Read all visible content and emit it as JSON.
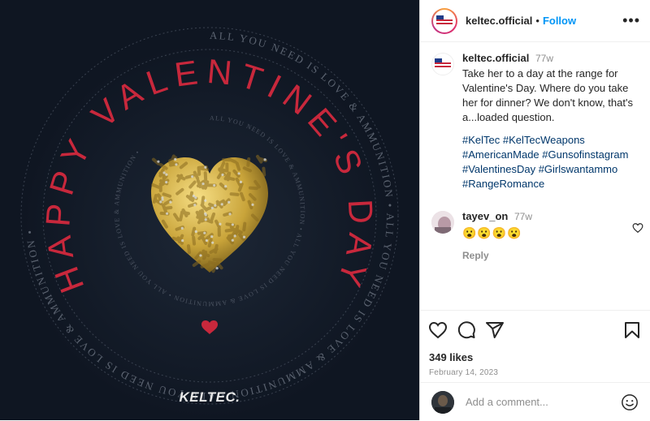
{
  "media": {
    "outer_ring_text": "ALL YOU NEED IS LOVE & AMMUNITION • ALL YOU NEED IS LOVE & AMMUNITION • ALL YOU NEED IS LOVE & AMMUNITION • ",
    "inner_ring_text": "ALL YOU NEED IS LOVE & AMMUNITION • ALL YOU NEED IS LOVE & AMMUNITION • ALL YOU NEED IS LOVE & AMMUNITION • ",
    "headline": "HAPPY VALENTINE'S DAY",
    "brand_logo": "KELTEC.",
    "colors": {
      "background": "#0f1622",
      "headline": "#c8283c",
      "ring_text": "#5b6370",
      "bullets": "#c9a43a"
    }
  },
  "header": {
    "username": "keltec.official",
    "separator": "•",
    "follow_label": "Follow",
    "more_label": "•••"
  },
  "caption": {
    "username": "keltec.official",
    "time": "77w",
    "text": "Take her to a day at the range for Valentine's Day. Where do you take her for dinner? We don't know, that's a...loaded question.",
    "hashtags": "#KelTec #KelTecWeapons #AmericanMade #Gunsofinstagram #ValentinesDay #Girlswantammo #RangeRomance"
  },
  "comment": {
    "username": "tayev_on",
    "time": "77w",
    "text": "😮😮😮😮",
    "reply_label": "Reply"
  },
  "actions": {
    "likes": "349 likes",
    "date": "February 14, 2023",
    "icons": [
      "heart-icon",
      "comment-icon",
      "share-icon",
      "bookmark-icon"
    ]
  },
  "add_comment": {
    "placeholder": "Add a comment..."
  }
}
